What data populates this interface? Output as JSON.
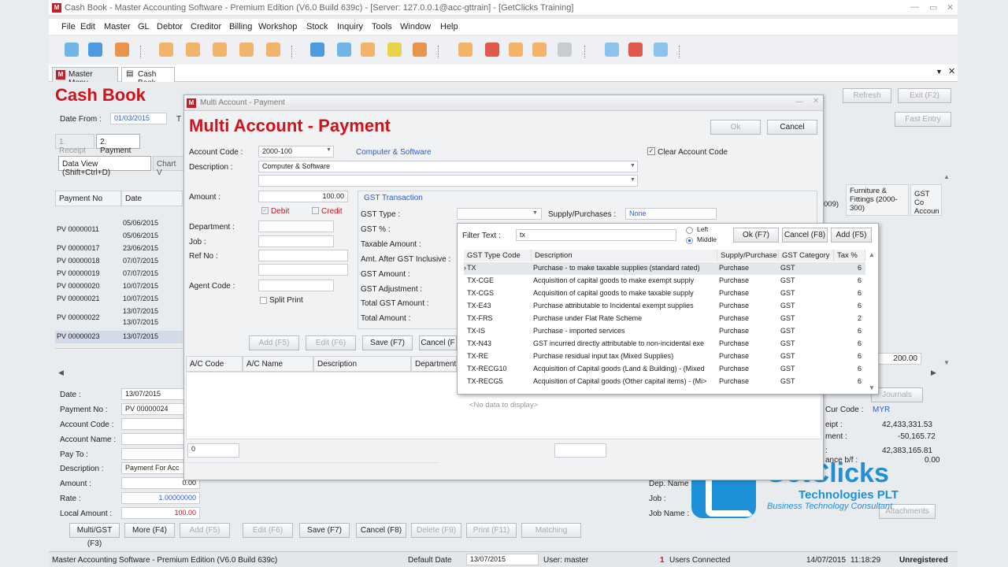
{
  "window": {
    "title": "Cash Book - Master Accounting Software - Premium Edition (V6.0 Build 639c) - [Server: 127.0.0.1@acc-gttrain] - [GetClicks Training]",
    "logo": "M"
  },
  "menu": [
    "File",
    "Edit",
    "Master",
    "GL",
    "Debtor",
    "Creditor",
    "Billing",
    "Workshop",
    "Stock",
    "Inquiry",
    "Tools",
    "Window",
    "Help"
  ],
  "tabs": [
    "Master Menu",
    "Cash Book"
  ],
  "cashbook": {
    "title": "Cash Book",
    "date_from_label": "Date From :",
    "date_from": "01/03/2015",
    "t_label": "T",
    "subtabs": [
      "1. Receipt",
      "2. Payment"
    ],
    "view_tabs": [
      "Data View (Shift+Ctrl+D)",
      "Chart V"
    ],
    "refresh": "Refresh",
    "exit": "Exit (F2)",
    "fast_entry": "Fast Entry",
    "grid_headers": [
      "Payment No",
      "Date"
    ],
    "rows": [
      {
        "no": "PV 00000011",
        "date": "05/06/2015"
      },
      {
        "no": "",
        "date": "05/06/2015"
      },
      {
        "no": "PV 00000017",
        "date": "23/06/2015"
      },
      {
        "no": "PV 00000018",
        "date": "07/07/2015"
      },
      {
        "no": "PV 00000019",
        "date": "07/07/2015"
      },
      {
        "no": "PV 00000020",
        "date": "10/07/2015"
      },
      {
        "no": "PV 00000021",
        "date": "10/07/2015"
      },
      {
        "no": "",
        "date": "13/07/2015"
      },
      {
        "no": "PV 00000022",
        "date": "13/07/2015"
      },
      {
        "no": "PV 00000023",
        "date": "13/07/2015"
      }
    ],
    "right_headers": [
      "Furniture & Fittings (2000-300)",
      "GST Co Accoun"
    ],
    "right_col_009": "009)",
    "right_value": "200.00",
    "form": {
      "date_label": "Date :",
      "date": "13/07/2015",
      "payment_no_label": "Payment No :",
      "payment_no": "PV 00000024",
      "account_code_label": "Account Code :",
      "account_name_label": "Account Name :",
      "pay_to_label": "Pay To :",
      "description_label": "Description :",
      "description": "Payment For Acc",
      "amount_label": "Amount :",
      "amount": "0.00",
      "rate_label": "Rate :",
      "rate": "1.00000000",
      "local_amount_label": "Local Amount :",
      "local_amount": "100.00"
    },
    "right_form": {
      "cur_code_label": "Cur Code :",
      "cur_code": "MYR",
      "receipt_label": "eipt :",
      "receipt": "42,433,331.53",
      "payment_label": "ment :",
      "payment": "-50,165.72",
      "blank_label": ":",
      "blank_value": "42,383,165.81",
      "balance_label": "ance b/f :",
      "balance": "0.00",
      "dep_name_label": "Dep. Name :",
      "job_label": "Job :",
      "job_name_label": "Job Name :",
      "journals": "Journals",
      "attachments": "Attachments"
    },
    "bottom_buttons": [
      "Multi/GST (F3)",
      "More (F4)",
      "Add (F5)",
      "Edit (F6)",
      "Save (F7)",
      "Cancel (F8)",
      "Delete (F9)",
      "Print (F11)",
      "Matching"
    ]
  },
  "dialog": {
    "window_title": "Multi Account - Payment",
    "title": "Multi Account - Payment",
    "ok": "Ok",
    "cancel": "Cancel",
    "account_code_label": "Account Code :",
    "account_code": "2000-100",
    "account_name": "Computer & Software",
    "clear_account_code": "Clear Account Code",
    "description_label": "Description :",
    "description": "Computer & Software",
    "amount_label": "Amount :",
    "amount": "100.00",
    "debit": "Debit",
    "credit": "Credit",
    "department_label": "Department :",
    "job_label": "Job :",
    "ref_no_label": "Ref No :",
    "agent_code_label": "Agent Code :",
    "split_print": "Split Print",
    "gst_transaction": "GST Transaction",
    "gst_type_label": "GST Type :",
    "supply_label": "Supply/Purchases :",
    "supply_value": "None",
    "gst_pct_label": "GST % :",
    "taxable_label": "Taxable Amount :",
    "amt_after_label": "Amt. After GST Inclusive :",
    "gst_amount_label": "GST Amount :",
    "gst_adj_label": "GST Adjustment :",
    "total_gst_label": "Total GST Amount :",
    "total_amount_label": "Total Amount :",
    "buttons": [
      "Add (F5)",
      "Edit (F6)",
      "Save (F7)",
      "Cancel (F"
    ],
    "grid_headers": [
      "A/C Code",
      "A/C Name",
      "Description",
      "Department"
    ],
    "no_data": "<No data to display>",
    "footer_value": "0"
  },
  "popup": {
    "filter_label": "Filter Text :",
    "filter_value": "tx",
    "left": "Left",
    "middle": "Middle",
    "ok": "Ok (F7)",
    "cancel": "Cancel (F8)",
    "add": "Add (F5)",
    "headers": [
      "GST Type Code",
      "Description",
      "Supply/Purchase",
      "GST Category",
      "Tax %"
    ],
    "rows": [
      {
        "code": "TX",
        "desc": "Purchase - to make taxable supplies (standard rated)",
        "sp": "Purchase",
        "cat": "GST",
        "tax": "6"
      },
      {
        "code": "TX-CGE",
        "desc": "Acquisition of capital goods to make exempt supply",
        "sp": "Purchase",
        "cat": "GST",
        "tax": "6"
      },
      {
        "code": "TX-CGS",
        "desc": "Acquisition of capital goods to make taxable supply",
        "sp": "Purchase",
        "cat": "GST",
        "tax": "6"
      },
      {
        "code": "TX-E43",
        "desc": "Purchase attributable to Incidental exempt supplies",
        "sp": "Purchase",
        "cat": "GST",
        "tax": "6"
      },
      {
        "code": "TX-FRS",
        "desc": "Purchase under Flat Rate Scheme",
        "sp": "Purchase",
        "cat": "GST",
        "tax": "2"
      },
      {
        "code": "TX-IS",
        "desc": "Purchase - imported services",
        "sp": "Purchase",
        "cat": "GST",
        "tax": "6"
      },
      {
        "code": "TX-N43",
        "desc": "GST incurred directly attributable to non-incidental exe",
        "sp": "Purchase",
        "cat": "GST",
        "tax": "6"
      },
      {
        "code": "TX-RE",
        "desc": "Purchase residual input tax (Mixed Supplies)",
        "sp": "Purchase",
        "cat": "GST",
        "tax": "6"
      },
      {
        "code": "TX-RECG10",
        "desc": "Acquisition of Capital goods (Land & Building) - (Mixed",
        "sp": "Purchase",
        "cat": "GST",
        "tax": "6"
      },
      {
        "code": "TX-RECG5",
        "desc": "Acquisition of Capital goods (Other capital items) - (Mi>",
        "sp": "Purchase",
        "cat": "GST",
        "tax": "6"
      }
    ]
  },
  "status": {
    "app": "Master Accounting Software - Premium Edition (V6.0 Build 639c)",
    "default_date_label": "Default Date",
    "default_date": "13/07/2015",
    "user": "User: master",
    "users_count": "1",
    "users_connected": "Users Connected",
    "date": "14/07/2015",
    "time": "11:18:29",
    "reg": "Unregistered"
  },
  "brand": {
    "name": "GetClicks",
    "tagline": "Technologies PLT",
    "sub": "Business Technology Consultant",
    "color": "#1e8fd9"
  }
}
